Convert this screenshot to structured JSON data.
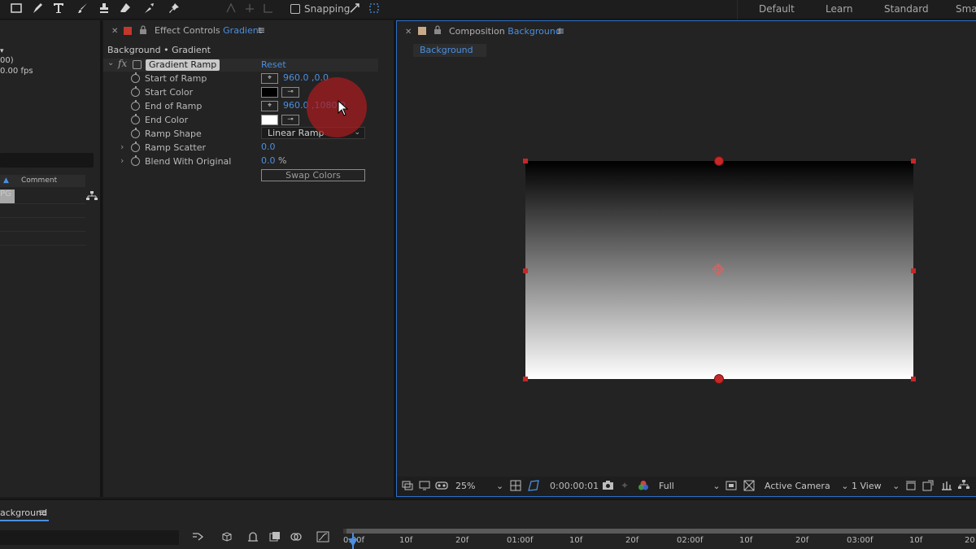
{
  "workspaces": [
    "Default",
    "Learn",
    "Standard",
    "Smal"
  ],
  "toolbar": {
    "snapping_label": "Snapping"
  },
  "project_panel": {
    "info_line1": "00)",
    "info_line2": "0.00 fps",
    "column_comment": "Comment",
    "row_text": "PG"
  },
  "effect_controls": {
    "panel_label": "Effect Controls",
    "panel_target": "Gradient",
    "layer_path": "Background • Gradient",
    "effect_name": "Gradient Ramp",
    "reset_label": "Reset",
    "properties": {
      "start_of_ramp": {
        "label": "Start of Ramp",
        "value": "960.0 ,0.0"
      },
      "start_color": {
        "label": "Start Color",
        "color": "#000000"
      },
      "end_of_ramp": {
        "label": "End of Ramp",
        "value": "960.0 ,1080.0"
      },
      "end_color": {
        "label": "End Color",
        "color": "#ffffff"
      },
      "ramp_shape": {
        "label": "Ramp Shape",
        "value": "Linear Ramp"
      },
      "ramp_scatter": {
        "label": "Ramp Scatter",
        "value": "0.0"
      },
      "blend_with_original": {
        "label": "Blend With Original",
        "value": "0.0",
        "unit": "%"
      }
    },
    "swap_colors_label": "Swap Colors"
  },
  "composition": {
    "panel_label": "Composition",
    "panel_target": "Background",
    "tab_label": "Background",
    "footer": {
      "zoom": "25%",
      "timecode": "0:00:00:01",
      "resolution": "Full",
      "camera": "Active Camera",
      "views": "1 View"
    }
  },
  "timeline": {
    "tab_label": "ackground",
    "ticks": [
      "0:00f",
      "10f",
      "20f",
      "01:00f",
      "10f",
      "20f",
      "02:00f",
      "10f",
      "20f",
      "03:00f",
      "10f",
      "20"
    ]
  },
  "colors": {
    "accent": "#4a8fe0",
    "handle": "#c62828",
    "panel_swatch_effect": "#c0392b",
    "panel_swatch_comp": "#c8a98a"
  }
}
